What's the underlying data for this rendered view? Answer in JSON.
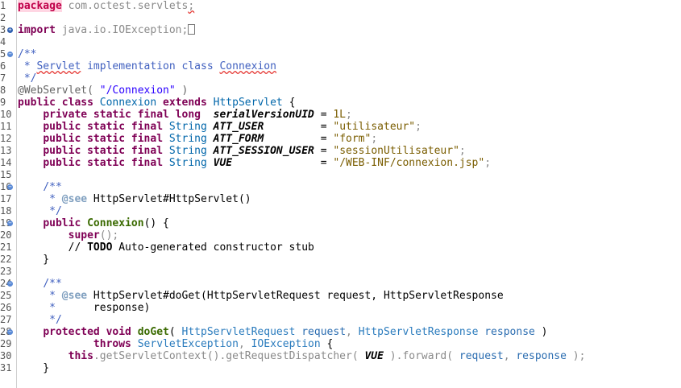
{
  "editor": {
    "lines": [
      {
        "n": "1",
        "parts": [
          {
            "c": "pkghl",
            "t": "package"
          },
          {
            "c": "gray",
            "t": " com.octest.servlets"
          },
          {
            "c": "gray squig",
            "t": ";"
          }
        ]
      },
      {
        "n": "2",
        "parts": []
      },
      {
        "n": "3",
        "fold": "plus",
        "parts": [
          {
            "c": "kw",
            "t": "import"
          },
          {
            "c": "gray",
            "t": " java.io.IOException;"
          },
          {
            "c": "box",
            "t": ""
          }
        ]
      },
      {
        "n": "4",
        "parts": []
      },
      {
        "n": "5",
        "fold": "minus",
        "parts": [
          {
            "c": "doc",
            "t": "/**"
          }
        ]
      },
      {
        "n": "6",
        "parts": [
          {
            "c": "doc",
            "t": " * "
          },
          {
            "c": "doc squig",
            "t": "Servlet"
          },
          {
            "c": "doc",
            "t": " implementation class "
          },
          {
            "c": "doc squig",
            "t": "Connexion"
          }
        ]
      },
      {
        "n": "7",
        "parts": [
          {
            "c": "doc",
            "t": " */"
          }
        ]
      },
      {
        "n": "8",
        "parts": [
          {
            "c": "ann",
            "t": "@WebServlet( "
          },
          {
            "c": "str-dk",
            "t": "\"/Connexion\""
          },
          {
            "c": "ann",
            "t": " )"
          }
        ]
      },
      {
        "n": "9",
        "parts": [
          {
            "c": "kw",
            "t": "public class "
          },
          {
            "c": "type",
            "t": "Connexion "
          },
          {
            "c": "kw",
            "t": "extends "
          },
          {
            "c": "type",
            "t": "HttpServlet"
          },
          {
            "c": "",
            "t": " {"
          }
        ]
      },
      {
        "n": "10",
        "parts": [
          {
            "c": "",
            "t": "    "
          },
          {
            "c": "kw",
            "t": "private static final long  "
          },
          {
            "c": "fld",
            "t": "serialVersionUID"
          },
          {
            "c": "",
            "t": " = "
          },
          {
            "c": "num",
            "t": "1L"
          },
          {
            "c": "gray",
            "t": ";"
          }
        ]
      },
      {
        "n": "11",
        "parts": [
          {
            "c": "",
            "t": "    "
          },
          {
            "c": "kw",
            "t": "public static final "
          },
          {
            "c": "type",
            "t": "String "
          },
          {
            "c": "fld",
            "t": "ATT_USER"
          },
          {
            "c": "",
            "t": "         = "
          },
          {
            "c": "str",
            "t": "\"utilisateur\""
          },
          {
            "c": "gray",
            "t": ";"
          }
        ]
      },
      {
        "n": "12",
        "parts": [
          {
            "c": "",
            "t": "    "
          },
          {
            "c": "kw",
            "t": "public static final "
          },
          {
            "c": "type",
            "t": "String "
          },
          {
            "c": "fld",
            "t": "ATT_FORM"
          },
          {
            "c": "",
            "t": "         = "
          },
          {
            "c": "str",
            "t": "\"form\""
          },
          {
            "c": "gray",
            "t": ";"
          }
        ]
      },
      {
        "n": "13",
        "parts": [
          {
            "c": "",
            "t": "    "
          },
          {
            "c": "kw",
            "t": "public static final "
          },
          {
            "c": "type",
            "t": "String "
          },
          {
            "c": "fld",
            "t": "ATT_SESSION_USER"
          },
          {
            "c": "",
            "t": " = "
          },
          {
            "c": "str",
            "t": "\"sessionUtilisateur\""
          },
          {
            "c": "gray",
            "t": ";"
          }
        ]
      },
      {
        "n": "14",
        "parts": [
          {
            "c": "",
            "t": "    "
          },
          {
            "c": "kw",
            "t": "public static final "
          },
          {
            "c": "type",
            "t": "String "
          },
          {
            "c": "fld",
            "t": "VUE"
          },
          {
            "c": "",
            "t": "              = "
          },
          {
            "c": "str",
            "t": "\"/WEB-INF/connexion.jsp\""
          },
          {
            "c": "gray",
            "t": ";"
          }
        ]
      },
      {
        "n": "15",
        "parts": []
      },
      {
        "n": "16",
        "fold": "minus",
        "parts": [
          {
            "c": "",
            "t": "    "
          },
          {
            "c": "doc",
            "t": "/**"
          }
        ]
      },
      {
        "n": "17",
        "parts": [
          {
            "c": "",
            "t": "     "
          },
          {
            "c": "doc",
            "t": "* "
          },
          {
            "c": "tag",
            "t": "@see"
          },
          {
            "c": "",
            "t": " HttpServlet#HttpServlet()"
          }
        ]
      },
      {
        "n": "18",
        "parts": [
          {
            "c": "",
            "t": "     "
          },
          {
            "c": "doc",
            "t": "*/"
          }
        ]
      },
      {
        "n": "19",
        "fold": "minus",
        "parts": [
          {
            "c": "",
            "t": "    "
          },
          {
            "c": "kw",
            "t": "public "
          },
          {
            "c": "method",
            "t": "Connexion"
          },
          {
            "c": "",
            "t": "() {"
          }
        ]
      },
      {
        "n": "20",
        "parts": [
          {
            "c": "",
            "t": "        "
          },
          {
            "c": "kw",
            "t": "super"
          },
          {
            "c": "gray",
            "t": "();"
          }
        ]
      },
      {
        "n": "21",
        "parts": [
          {
            "c": "",
            "t": "        // "
          },
          {
            "c": "",
            "t": "TODO",
            "b": true
          },
          {
            "c": "",
            "t": " Auto-generated constructor stub"
          }
        ]
      },
      {
        "n": "22",
        "parts": [
          {
            "c": "",
            "t": "    }"
          }
        ]
      },
      {
        "n": "23",
        "parts": []
      },
      {
        "n": "24",
        "fold": "minus",
        "parts": [
          {
            "c": "",
            "t": "    "
          },
          {
            "c": "doc",
            "t": "/**"
          }
        ]
      },
      {
        "n": "25",
        "parts": [
          {
            "c": "",
            "t": "     "
          },
          {
            "c": "doc",
            "t": "* "
          },
          {
            "c": "tag",
            "t": "@see"
          },
          {
            "c": "",
            "t": " HttpServlet#doGet(HttpServletRequest request, HttpServletResponse"
          }
        ]
      },
      {
        "n": "26",
        "parts": [
          {
            "c": "",
            "t": "     "
          },
          {
            "c": "doc",
            "t": "*"
          },
          {
            "c": "",
            "t": "      response)"
          }
        ]
      },
      {
        "n": "27",
        "parts": [
          {
            "c": "",
            "t": "     "
          },
          {
            "c": "doc",
            "t": "*/"
          }
        ]
      },
      {
        "n": "28",
        "fold": "minus",
        "parts": [
          {
            "c": "",
            "t": "    "
          },
          {
            "c": "kw",
            "t": "protected void "
          },
          {
            "c": "method",
            "t": "doGet"
          },
          {
            "c": "",
            "t": "( "
          },
          {
            "c": "type2",
            "t": "HttpServletRequest "
          },
          {
            "c": "var",
            "t": "request"
          },
          {
            "c": "gray",
            "t": ", "
          },
          {
            "c": "type2",
            "t": "HttpServletResponse "
          },
          {
            "c": "var",
            "t": "response"
          },
          {
            "c": "",
            "t": " )"
          }
        ]
      },
      {
        "n": "29",
        "parts": [
          {
            "c": "",
            "t": "            "
          },
          {
            "c": "kw",
            "t": "throws "
          },
          {
            "c": "type2",
            "t": "ServletException"
          },
          {
            "c": "gray",
            "t": ", "
          },
          {
            "c": "type2",
            "t": "IOException"
          },
          {
            "c": "",
            "t": " {"
          }
        ]
      },
      {
        "n": "30",
        "parts": [
          {
            "c": "",
            "t": "        "
          },
          {
            "c": "kw",
            "t": "this"
          },
          {
            "c": "gray",
            "t": ".getServletContext().getRequestDispatcher( "
          },
          {
            "c": "fld",
            "t": "VUE"
          },
          {
            "c": "gray",
            "t": " ).forward( "
          },
          {
            "c": "var",
            "t": "request"
          },
          {
            "c": "gray",
            "t": ", "
          },
          {
            "c": "var",
            "t": "response"
          },
          {
            "c": "gray",
            "t": " );"
          }
        ]
      },
      {
        "n": "31",
        "parts": [
          {
            "c": "",
            "t": "    }"
          }
        ]
      }
    ]
  }
}
